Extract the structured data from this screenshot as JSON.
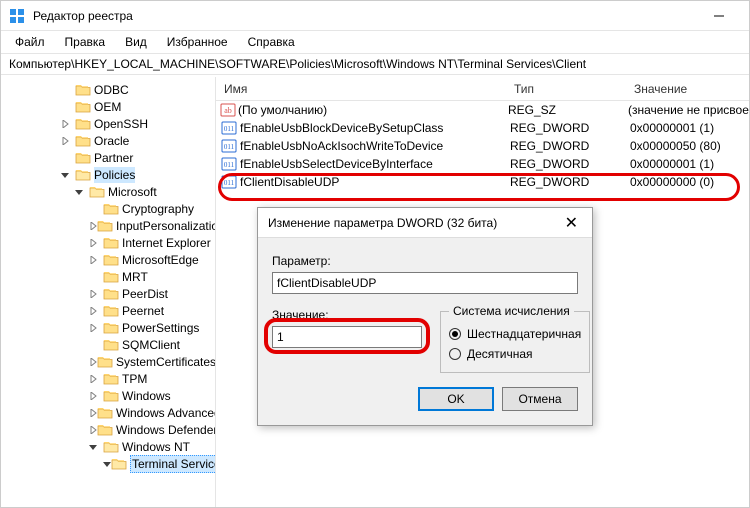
{
  "window": {
    "title": "Редактор реестра"
  },
  "menu": [
    "Файл",
    "Правка",
    "Вид",
    "Избранное",
    "Справка"
  ],
  "address": "Компьютер\\HKEY_LOCAL_MACHINE\\SOFTWARE\\Policies\\Microsoft\\Windows NT\\Terminal Services\\Client",
  "tree": [
    {
      "ind": 4,
      "tw": "",
      "label": "ODBC"
    },
    {
      "ind": 4,
      "tw": "",
      "label": "OEM"
    },
    {
      "ind": 4,
      "tw": ">",
      "label": "OpenSSH"
    },
    {
      "ind": 4,
      "tw": ">",
      "label": "Oracle"
    },
    {
      "ind": 4,
      "tw": "",
      "label": "Partner"
    },
    {
      "ind": 4,
      "tw": "v",
      "label": "Policies",
      "sel": true
    },
    {
      "ind": 5,
      "tw": "v",
      "label": "Microsoft"
    },
    {
      "ind": 6,
      "tw": "",
      "label": "Cryptography"
    },
    {
      "ind": 6,
      "tw": ">",
      "label": "InputPersonalization"
    },
    {
      "ind": 6,
      "tw": ">",
      "label": "Internet Explorer"
    },
    {
      "ind": 6,
      "tw": ">",
      "label": "MicrosoftEdge"
    },
    {
      "ind": 6,
      "tw": "",
      "label": "MRT"
    },
    {
      "ind": 6,
      "tw": ">",
      "label": "PeerDist"
    },
    {
      "ind": 6,
      "tw": ">",
      "label": "Peernet"
    },
    {
      "ind": 6,
      "tw": ">",
      "label": "PowerSettings"
    },
    {
      "ind": 6,
      "tw": "",
      "label": "SQMClient"
    },
    {
      "ind": 6,
      "tw": ">",
      "label": "SystemCertificates"
    },
    {
      "ind": 6,
      "tw": ">",
      "label": "TPM"
    },
    {
      "ind": 6,
      "tw": ">",
      "label": "Windows"
    },
    {
      "ind": 6,
      "tw": ">",
      "label": "Windows Advanced Threat Protection"
    },
    {
      "ind": 6,
      "tw": ">",
      "label": "Windows Defender"
    },
    {
      "ind": 6,
      "tw": "v",
      "label": "Windows NT"
    },
    {
      "ind": 7,
      "tw": "v",
      "label": "Terminal Services",
      "selActive": true
    }
  ],
  "list": {
    "headers": {
      "name": "Имя",
      "type": "Тип",
      "value": "Значение"
    },
    "rows": [
      {
        "icon": "sz",
        "name": "(По умолчанию)",
        "type": "REG_SZ",
        "value": "(значение не присвоено)"
      },
      {
        "icon": "dw",
        "name": "fEnableUsbBlockDeviceBySetupClass",
        "type": "REG_DWORD",
        "value": "0x00000001 (1)"
      },
      {
        "icon": "dw",
        "name": "fEnableUsbNoAckIsochWriteToDevice",
        "type": "REG_DWORD",
        "value": "0x00000050 (80)"
      },
      {
        "icon": "dw",
        "name": "fEnableUsbSelectDeviceByInterface",
        "type": "REG_DWORD",
        "value": "0x00000001 (1)"
      },
      {
        "icon": "dw",
        "name": "fClientDisableUDP",
        "type": "REG_DWORD",
        "value": "0x00000000 (0)"
      }
    ]
  },
  "dialog": {
    "title": "Изменение параметра DWORD (32 бита)",
    "param_label": "Параметр:",
    "param_value": "fClientDisableUDP",
    "value_label": "Значение:",
    "value_value": "1",
    "base_label": "Система исчисления",
    "radio_hex": "Шестнадцатеричная",
    "radio_dec": "Десятичная",
    "ok": "OK",
    "cancel": "Отмена"
  }
}
